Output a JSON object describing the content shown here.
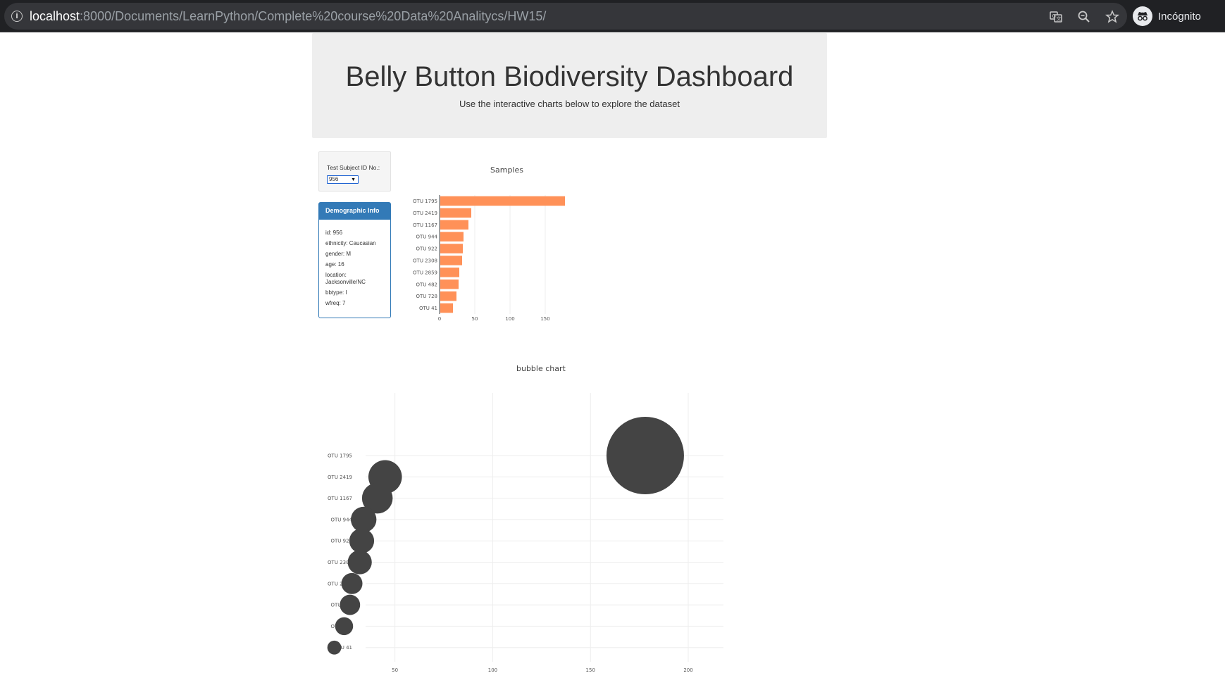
{
  "browser": {
    "url_host": "localhost",
    "url_path": ":8000/Documents/LearnPython/Complete%20course%20Data%20Analitycs/HW15/",
    "profile_label": "Incógnito",
    "icons": [
      "info-icon",
      "translate-icon",
      "zoom-icon",
      "star-icon",
      "incognito-icon"
    ]
  },
  "header": {
    "title": "Belly Button Biodiversity Dashboard",
    "subtitle": "Use the interactive charts below to explore the dataset"
  },
  "selector": {
    "label": "Test Subject ID No.:",
    "selected": "956"
  },
  "demographics": {
    "heading": "Demographic Info",
    "rows": [
      "id: 956",
      "ethnicity: Caucasian",
      "gender: M",
      "age: 16",
      "location: Jacksonville/NC",
      "bbtype: I",
      "wfreq: 7"
    ]
  },
  "colors": {
    "bar_fill": "#ff9158",
    "bubble_fill": "#444444",
    "panel_primary": "#337ab7",
    "jumbotron_bg": "#eeeeee"
  },
  "chart_data": [
    {
      "type": "bar",
      "orientation": "horizontal",
      "title": "Samples",
      "categories": [
        "OTU 1795",
        "OTU 2419",
        "OTU 1167",
        "OTU 944",
        "OTU 922",
        "OTU 2308",
        "OTU 2859",
        "OTU 482",
        "OTU 728",
        "OTU 41"
      ],
      "values": [
        178,
        45,
        41,
        34,
        33,
        32,
        28,
        27,
        24,
        19
      ],
      "xlim": [
        0,
        182
      ],
      "xticks": [
        0,
        50,
        100,
        150
      ],
      "grid": true
    },
    {
      "type": "scatter",
      "variant": "bubble",
      "title": "bubble chart",
      "categories": [
        "OTU 1795",
        "OTU 2419",
        "OTU 1167",
        "OTU 944",
        "OTU 922",
        "OTU 2308",
        "OTU 2859",
        "OTU 482",
        "OTU 728",
        "OTU 41"
      ],
      "values": [
        178,
        45,
        41,
        34,
        33,
        32,
        28,
        27,
        24,
        19
      ],
      "xlim": [
        35,
        218
      ],
      "xticks": [
        50,
        100,
        150,
        200
      ],
      "grid": true
    }
  ]
}
